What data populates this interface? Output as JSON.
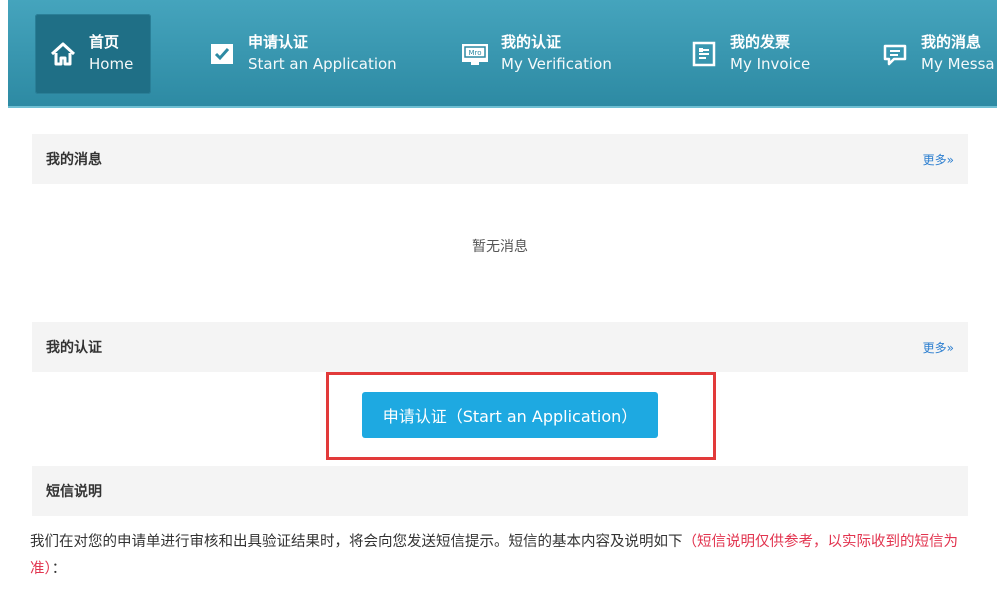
{
  "nav": {
    "items": [
      {
        "cn": "首页",
        "en": "Home",
        "icon": "home-icon"
      },
      {
        "cn": "申请认证",
        "en": "Start an Application",
        "icon": "checkbox-icon"
      },
      {
        "cn": "我的认证",
        "en": "My Verification",
        "icon": "certificate-icon"
      },
      {
        "cn": "我的发票",
        "en": "My Invoice",
        "icon": "invoice-icon"
      },
      {
        "cn": "我的消息",
        "en": "My Messa",
        "icon": "message-icon"
      }
    ]
  },
  "messages": {
    "title": "我的消息",
    "more": "更多»",
    "empty": "暂无消息"
  },
  "verification": {
    "title": "我的认证",
    "more": "更多»",
    "apply_button": "申请认证（Start an Application）"
  },
  "sms": {
    "title": "短信说明",
    "text": "我们在对您的申请单进行审核和出具验证结果时，将会向您发送短信提示。短信的基本内容及说明如下",
    "note": "（短信说明仅供参考，以实际收到的短信为准）",
    "tail": "："
  },
  "colors": {
    "nav_bg": "#3a9ab3",
    "nav_active": "#1f6f86",
    "button": "#1ea9e1",
    "highlight": "#e23a3a",
    "note_red": "#e2344f",
    "link": "#2d7fd0"
  }
}
